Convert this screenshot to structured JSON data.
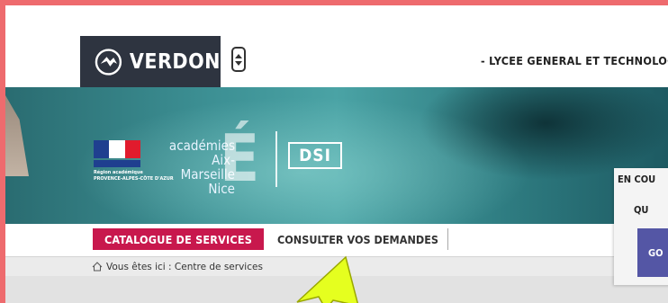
{
  "header": {
    "brand": "VERDON",
    "school": "- LYCEE GENERAL ET TECHNOLOGIQUE"
  },
  "banner": {
    "academies_line1": "académies",
    "academies_line2": "Aix-Marseille",
    "academies_line3": "Nice",
    "region_line1": "Région académique",
    "region_line2": "PROVENCE-ALPES-CÔTE D'AZUR",
    "big_letter": "É",
    "dsi_label": "DSI"
  },
  "nav": {
    "catalogue": "CATALOGUE DE SERVICES",
    "consulter": "CONSULTER VOS DEMANDES"
  },
  "breadcrumb": {
    "text": "Vous êtes ici : Centre de services"
  },
  "panel": {
    "title": "EN COU",
    "question": "QU",
    "button": "GO"
  },
  "colors": {
    "accent": "#c8184d",
    "dark": "#2e3440",
    "panel_button": "#5456a5",
    "outer_border": "#ee6b6e",
    "arrow": "#e5ff1f"
  }
}
